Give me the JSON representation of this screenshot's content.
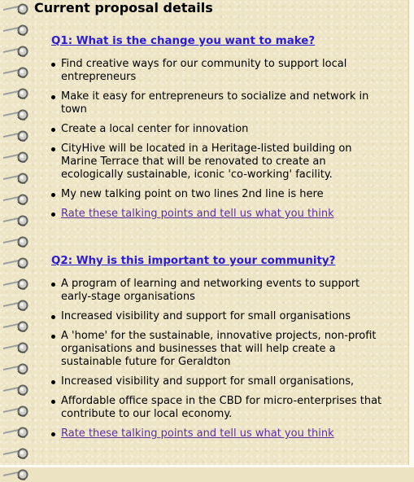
{
  "page_title": "Current proposal details",
  "sections": [
    {
      "question": "Q1: What is the change you want to make?",
      "items": [
        "Find creative ways for our community to support local entrepreneurs",
        "Make it easy for entrepreneurs to socialize and network in town",
        "Create a local center for innovation",
        "CityHive will be located in a Heritage-listed building on Marine Terrace that will be renovated to create an ecologically sustainable, iconic 'co-working' facility.",
        "My new talking point on two lines 2nd line is here"
      ],
      "rate_link": "Rate these talking points and tell us what you think"
    },
    {
      "question": "Q2: Why is this important to your community?",
      "items": [
        "A program of learning and networking events to support early-stage organisations",
        "Increased visibility and support for small organisations",
        "A 'home' for the sustainable, innovative projects, non-profit organisations and businesses that will help create a sustainable future for Geraldton",
        "Increased visibility and support for small organisations,",
        "Affordable office space in the CBD for micro-enterprises that contribute to our local economy."
      ],
      "rate_link": "Rate these talking points and tell us what you think"
    }
  ],
  "colors": {
    "question_link": "#2b1bd1",
    "rate_link": "#5b2ea3",
    "paper": "#eee5c6"
  },
  "icons": {
    "binding": "spiral-ring-icon"
  }
}
